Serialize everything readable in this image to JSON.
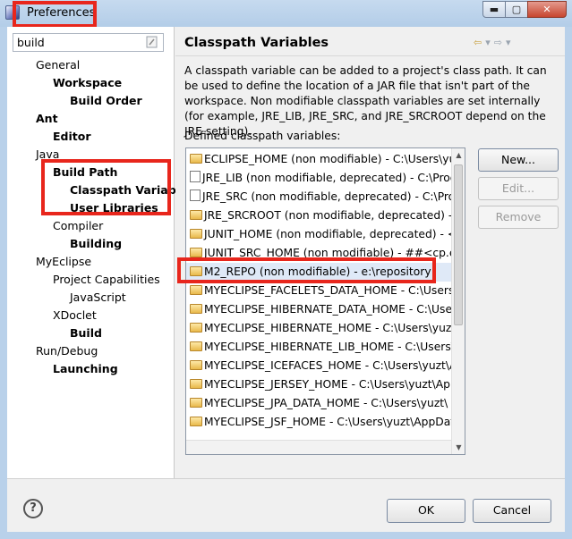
{
  "window": {
    "title": "Preferences",
    "minimize_glyph": "▬",
    "maximize_glyph": "▢",
    "close_glyph": "✕"
  },
  "filter": {
    "value": "build",
    "clear_icon": "clear-filter-icon"
  },
  "tree": [
    {
      "label": "General",
      "bold": false
    },
    {
      "label": "Workspace",
      "bold": true
    },
    {
      "label": "Build Order",
      "bold": true
    },
    {
      "label": "Ant",
      "bold": true
    },
    {
      "label": "Editor",
      "bold": true
    },
    {
      "label": "Java",
      "bold": false
    },
    {
      "label": "Build Path",
      "bold": true
    },
    {
      "label": "Classpath Variab",
      "bold": true
    },
    {
      "label": "User Libraries",
      "bold": true
    },
    {
      "label": "Compiler",
      "bold": false
    },
    {
      "label": "Building",
      "bold": true
    },
    {
      "label": "MyEclipse",
      "bold": false
    },
    {
      "label": "Project Capabilities",
      "bold": false
    },
    {
      "label": "JavaScript",
      "bold": false
    },
    {
      "label": "XDoclet",
      "bold": false
    },
    {
      "label": "Build",
      "bold": true
    },
    {
      "label": "Run/Debug",
      "bold": false
    },
    {
      "label": "Launching",
      "bold": true
    }
  ],
  "page": {
    "title": "Classpath Variables",
    "description": "A classpath variable can be added to a project's class path. It can be used to define the location of a JAR file that isn't part of the workspace. Non modifiable classpath variables are set internally (for example, JRE_LIB, JRE_SRC, and JRE_SRCROOT depend on the JRE setting).",
    "list_label": "Defined classpath variables:",
    "nav": {
      "back": "⇦",
      "back_menu": "▾",
      "forward": "⇨",
      "menu": "▾"
    }
  },
  "variables": [
    {
      "text": "ECLIPSE_HOME (non modifiable) - C:\\Users\\yuzt",
      "icon": "folder",
      "selected": false
    },
    {
      "text": "JRE_LIB (non modifiable, deprecated) - C:\\Progr",
      "icon": "jar",
      "selected": false
    },
    {
      "text": "JRE_SRC (non modifiable, deprecated) - C:\\Prog",
      "icon": "jar",
      "selected": false
    },
    {
      "text": "JRE_SRCROOT (non modifiable, deprecated) - (e",
      "icon": "folder",
      "selected": false
    },
    {
      "text": "JUNIT_HOME (non modifiable, deprecated) - <c",
      "icon": "folder",
      "selected": false
    },
    {
      "text": "JUNIT_SRC_HOME (non modifiable) - ##<cp.ent",
      "icon": "folder",
      "selected": false
    },
    {
      "text": "M2_REPO (non modifiable) - e:\\repository",
      "icon": "folder",
      "selected": true
    },
    {
      "text": "MYECLIPSE_FACELETS_DATA_HOME - C:\\Users\\yz",
      "icon": "folder",
      "selected": false
    },
    {
      "text": "MYECLIPSE_HIBERNATE_DATA_HOME - C:\\Users\\",
      "icon": "folder",
      "selected": false
    },
    {
      "text": "MYECLIPSE_HIBERNATE_HOME - C:\\Users\\yuzt\\",
      "icon": "folder",
      "selected": false
    },
    {
      "text": "MYECLIPSE_HIBERNATE_LIB_HOME - C:\\Users\\yu",
      "icon": "folder",
      "selected": false
    },
    {
      "text": "MYECLIPSE_ICEFACES_HOME - C:\\Users\\yuzt\\App",
      "icon": "folder",
      "selected": false
    },
    {
      "text": "MYECLIPSE_JERSEY_HOME - C:\\Users\\yuzt\\AppD",
      "icon": "folder",
      "selected": false
    },
    {
      "text": "MYECLIPSE_JPA_DATA_HOME - C:\\Users\\yuzt\\",
      "icon": "folder",
      "selected": false
    },
    {
      "text": "MYECLIPSE_JSF_HOME - C:\\Users\\yuzt\\AppData\\",
      "icon": "folder",
      "selected": false
    }
  ],
  "buttons": {
    "new": "New...",
    "edit": "Edit...",
    "remove": "Remove",
    "ok": "OK",
    "cancel": "Cancel",
    "help": "?"
  },
  "colors": {
    "highlight_red": "#e8261c",
    "selection": "#dfe9f7",
    "window_frame": "#b9d1ea"
  }
}
